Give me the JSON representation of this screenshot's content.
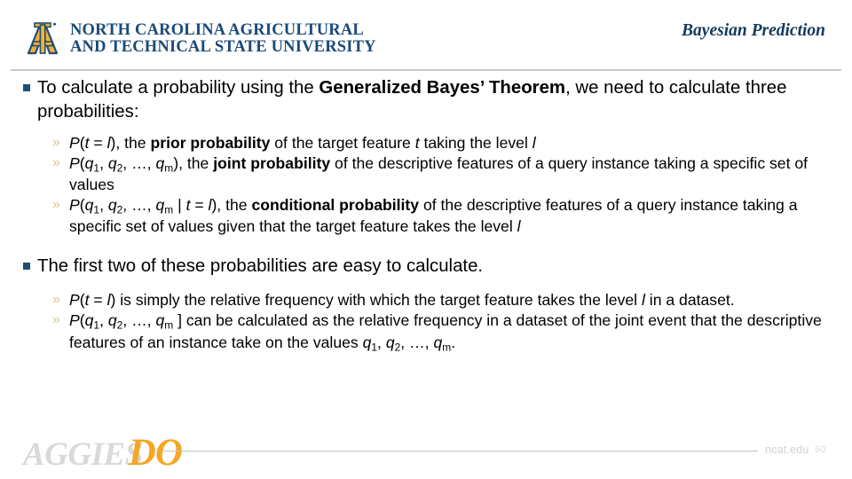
{
  "header": {
    "logo": {
      "icon": "ncat-aggie-monogram-icon",
      "line1_initial": "N",
      "line1_rest": "ORTH ",
      "line1_initial2": "C",
      "line1_rest2": "AROLINA ",
      "line1_initial3": "A",
      "line1_rest3": "GRICULTURAL",
      "line1_full": "NORTH CAROLINA AGRICULTURAL",
      "line2_full": "AND TECHNICAL STATE UNIVERSITY"
    },
    "title": "Bayesian Prediction"
  },
  "content": {
    "bullet1": {
      "text_a": "To calculate a probability using the ",
      "bold_b": "Generalized Bayes’ Theorem",
      "text_c": ", we need to calculate three probabilities:"
    },
    "sub1": {
      "formula_p": "P",
      "formula_body": "(",
      "formula_t": "t",
      "formula_eq": " = ",
      "formula_l": "l",
      "formula_close": "), the ",
      "bold": "prior probability",
      "tail_a": " of the target feature ",
      "tail_t": "t",
      "tail_b": " taking the level ",
      "tail_l": "l"
    },
    "sub2": {
      "bold": "joint probability",
      "tail": " of the descriptive features of a query instance taking a specific set of values"
    },
    "sub3": {
      "bold": "conditional probability",
      "tail": " of the descriptive features of a query instance taking a specific set of values given that the target feature takes the level ",
      "tail_l": "l"
    },
    "bullet2": {
      "text": "The first two of these probabilities are easy to calculate."
    },
    "sub4": {
      "tail_a": " is simply the relative frequency with which the target feature takes the level ",
      "tail_l": "l",
      "tail_b": " in a dataset."
    },
    "sub5": {
      "tail_a": " ] can be calculated as the relative frequency in a dataset of the joint event that the descriptive features of an instance take on the values ",
      "tail_end": "."
    },
    "math": {
      "P": "P",
      "open": "(",
      "q": "q",
      "sub_1": "1",
      "sub_2": "2",
      "sub_m": "m",
      "comma": ", ",
      "ellipsis": "…",
      "close": ")",
      "bracket_close": "]",
      "pipe": " | ",
      "t": "t",
      "eq": " = ",
      "l": "l"
    }
  },
  "footer": {
    "logo_aggies": "AGGIES",
    "logo_do": "DO",
    "url": "ncat.edu",
    "page_number": "60"
  },
  "colors": {
    "brand_navy": "#1f4e79",
    "brand_gold": "#f5a623",
    "title_navy": "#14395e",
    "chevron": "#d8c98a"
  }
}
